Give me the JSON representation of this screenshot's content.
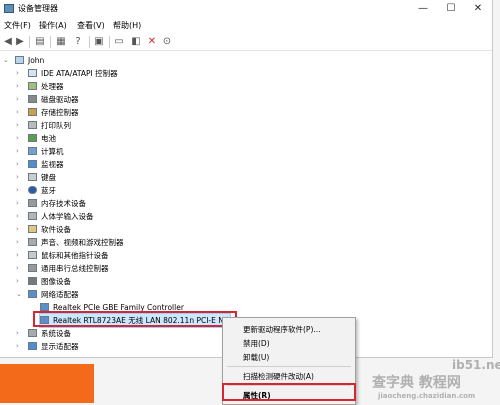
{
  "window": {
    "title": "设备管理器",
    "minimize": "—",
    "maximize": "☐",
    "close": "✕"
  },
  "menu": [
    "文件(F)",
    "操作(A)",
    "查看(V)",
    "帮助(H)"
  ],
  "tree": {
    "root": "John",
    "categories": [
      "IDE ATA/ATAPI 控制器",
      "处理器",
      "磁盘驱动器",
      "存储控制器",
      "打印队列",
      "电池",
      "计算机",
      "监视器",
      "键盘",
      "蓝牙",
      "内存技术设备",
      "人体学输入设备",
      "软件设备",
      "声音、视频和游戏控制器",
      "鼠标和其他指针设备",
      "通用串行总线控制器",
      "图像设备",
      "网络适配器"
    ],
    "network_children": [
      "Realtek PCIe GBE Family Controller",
      "Realtek RTL8723AE 无线 LAN 802.11n PCI-E NIC"
    ],
    "after": [
      "系统设备",
      "显示适配器"
    ]
  },
  "context_menu": {
    "items": [
      "更新驱动程序软件(P)...",
      "禁用(D)",
      "卸载(U)",
      "扫描检测硬件改动(A)",
      "属性(R)"
    ]
  },
  "watermark": {
    "site": "ib51.net",
    "brand": "查字典 教程网",
    "url": "jiaocheng.chazidian.com"
  },
  "colors": {
    "highlight": "#d6262f",
    "selection": "#cce8ff",
    "accent_orange": "#f26a1a"
  }
}
